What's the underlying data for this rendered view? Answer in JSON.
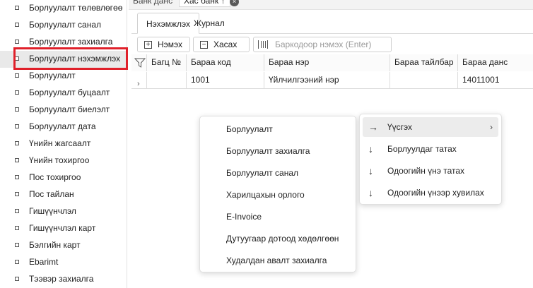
{
  "top_tabs": [
    {
      "label": "Банк данс"
    },
    {
      "label": "Хас банк ↑"
    }
  ],
  "sidebar": {
    "items": [
      {
        "label": "Борлуулалт төлөвлөгөө"
      },
      {
        "label": "Борлуулалт санал"
      },
      {
        "label": "Борлуулалт захиалга"
      },
      {
        "label": "Борлуулалт нэхэмжлэх"
      },
      {
        "label": "Борлуулалт"
      },
      {
        "label": "Борлуулалт буцаалт"
      },
      {
        "label": "Борлуулалт биелэлт"
      },
      {
        "label": "Борлуулалт дата"
      },
      {
        "label": "Үнийн жагсаалт"
      },
      {
        "label": "Үнийн тохиргоо"
      },
      {
        "label": "Пос тохиргоо"
      },
      {
        "label": "Пос тайлан"
      },
      {
        "label": "Гишүүнчлэл"
      },
      {
        "label": "Гишүүнчлэл карт"
      },
      {
        "label": "Бэлгийн карт"
      },
      {
        "label": "Ebarimt"
      },
      {
        "label": "Тээвэр захиалга"
      }
    ]
  },
  "sub_tabs": [
    {
      "label": "Нэхэмжлэх"
    },
    {
      "label": "Журнал"
    }
  ],
  "toolbar": {
    "add_label": "Нэмэх",
    "delete_label": "Хасах",
    "barcode_placeholder": "Баркодоор нэмэх (Enter)"
  },
  "grid": {
    "columns": [
      "Багц №",
      "Бараа код",
      "Бараа нэр",
      "Бараа тайлбар",
      "Бараа данс"
    ],
    "rows": [
      [
        "",
        "1001",
        "Үйлчилгээний нэр",
        "",
        "14011001"
      ]
    ]
  },
  "context_menu": {
    "items": [
      {
        "label": "Борлуулалт"
      },
      {
        "label": "Борлуулалт захиалга"
      },
      {
        "label": "Борлуулалт санал"
      },
      {
        "label": "Харилцахын орлого"
      },
      {
        "label": "E-Invoice"
      },
      {
        "label": "Дутуугаар дотоод хөдөлгөөн"
      },
      {
        "label": "Худалдан авалт захиалга"
      }
    ]
  },
  "action_menu": {
    "items": [
      {
        "label": "Үүсгэх",
        "icon": "arrow-right-icon"
      },
      {
        "label": "Борлуулдаг татах",
        "icon": "arrow-down-icon"
      },
      {
        "label": "Одоогийн үнэ татах",
        "icon": "arrow-down-icon"
      },
      {
        "label": "Одоогийн үнээр хувилах",
        "icon": "arrow-down-icon"
      }
    ]
  }
}
